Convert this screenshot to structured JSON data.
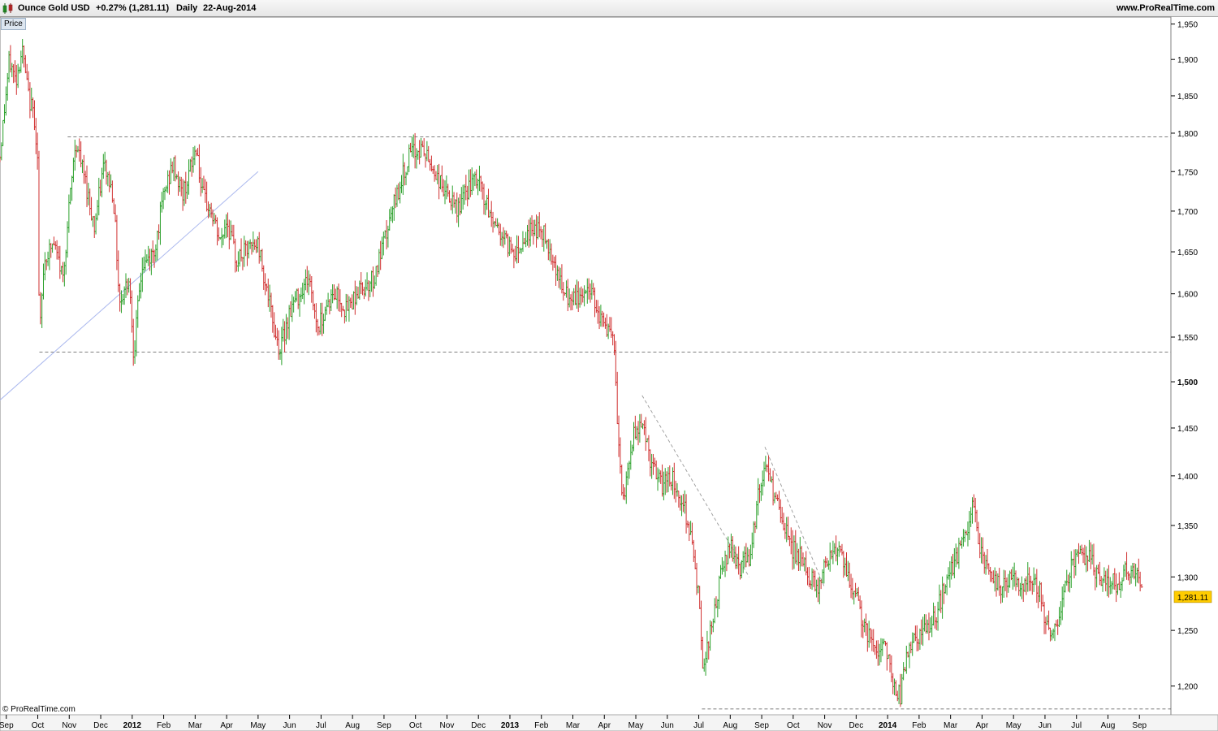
{
  "header": {
    "instrument": "Ounce Gold USD",
    "change": "+0.27% (1,281.11)",
    "period": "Daily",
    "date": "22-Aug-2014",
    "website": "www.ProRealTime.com"
  },
  "panel_label": "Price",
  "copyright": "© ProRealTime.com",
  "colors": {
    "up": "#2aa02a",
    "down": "#d03030",
    "last_price_bg": "#ffcc00",
    "trendline": "#aab8ee",
    "support_line": "#555555"
  },
  "chart_data": {
    "type": "bar",
    "title": "Ounce Gold USD",
    "timeframe": "Daily",
    "ylim": [
      1175,
      1960
    ],
    "y_ticks": [
      1200,
      1250,
      1300,
      1350,
      1400,
      1450,
      1500,
      1550,
      1600,
      1650,
      1700,
      1750,
      1800,
      1850,
      1900,
      1950
    ],
    "y_tick_labels": [
      "1,200",
      "1,250",
      "1,300",
      "1,350",
      "1,400",
      "1,450",
      "1,500",
      "1,550",
      "1,600",
      "1,650",
      "1,700",
      "1,750",
      "1,800",
      "1,850",
      "1,900",
      "1,950"
    ],
    "x_ticks": [
      {
        "label": "Sep",
        "month": 0
      },
      {
        "label": "Oct",
        "month": 1
      },
      {
        "label": "Nov",
        "month": 2
      },
      {
        "label": "Dec",
        "month": 3
      },
      {
        "label": "2012",
        "month": 4,
        "bold": true
      },
      {
        "label": "Feb",
        "month": 5
      },
      {
        "label": "Mar",
        "month": 6
      },
      {
        "label": "Apr",
        "month": 7
      },
      {
        "label": "May",
        "month": 8
      },
      {
        "label": "Jun",
        "month": 9
      },
      {
        "label": "Jul",
        "month": 10
      },
      {
        "label": "Aug",
        "month": 11
      },
      {
        "label": "Sep",
        "month": 12
      },
      {
        "label": "Oct",
        "month": 13
      },
      {
        "label": "Nov",
        "month": 14
      },
      {
        "label": "Dec",
        "month": 15
      },
      {
        "label": "2013",
        "month": 16,
        "bold": true
      },
      {
        "label": "Feb",
        "month": 17
      },
      {
        "label": "Mar",
        "month": 18
      },
      {
        "label": "Apr",
        "month": 19
      },
      {
        "label": "May",
        "month": 20
      },
      {
        "label": "Jun",
        "month": 21
      },
      {
        "label": "Jul",
        "month": 22
      },
      {
        "label": "Aug",
        "month": 23
      },
      {
        "label": "Sep",
        "month": 24
      },
      {
        "label": "Oct",
        "month": 25
      },
      {
        "label": "Nov",
        "month": 26
      },
      {
        "label": "Dec",
        "month": 27
      },
      {
        "label": "2014",
        "month": 28,
        "bold": true
      },
      {
        "label": "Feb",
        "month": 29
      },
      {
        "label": "Mar",
        "month": 30
      },
      {
        "label": "Apr",
        "month": 31
      },
      {
        "label": "May",
        "month": 32
      },
      {
        "label": "Jun",
        "month": 33
      },
      {
        "label": "Jul",
        "month": 34
      },
      {
        "label": "Aug",
        "month": 35
      },
      {
        "label": "Sep",
        "month": 36
      }
    ],
    "x_range_months": [
      -0.2,
      37.0
    ],
    "last_price": 1281.11,
    "last_price_label": "1,281.11",
    "price_path": [
      [
        -0.2,
        1770
      ],
      [
        0.1,
        1900
      ],
      [
        0.3,
        1870
      ],
      [
        0.5,
        1915
      ],
      [
        0.7,
        1850
      ],
      [
        0.9,
        1820
      ],
      [
        1.0,
        1760
      ],
      [
        1.05,
        1540
      ],
      [
        1.2,
        1640
      ],
      [
        1.5,
        1660
      ],
      [
        1.8,
        1620
      ],
      [
        2.2,
        1790
      ],
      [
        2.5,
        1740
      ],
      [
        2.8,
        1680
      ],
      [
        3.1,
        1760
      ],
      [
        3.4,
        1720
      ],
      [
        3.6,
        1590
      ],
      [
        3.9,
        1620
      ],
      [
        4.05,
        1530
      ],
      [
        4.3,
        1630
      ],
      [
        4.7,
        1650
      ],
      [
        5.0,
        1720
      ],
      [
        5.3,
        1760
      ],
      [
        5.6,
        1720
      ],
      [
        5.9,
        1760
      ],
      [
        6.05,
        1785
      ],
      [
        6.2,
        1720
      ],
      [
        6.5,
        1700
      ],
      [
        6.8,
        1660
      ],
      [
        7.0,
        1690
      ],
      [
        7.3,
        1640
      ],
      [
        7.6,
        1650
      ],
      [
        8.0,
        1660
      ],
      [
        8.3,
        1600
      ],
      [
        8.5,
        1560
      ],
      [
        8.7,
        1535
      ],
      [
        9.0,
        1580
      ],
      [
        9.3,
        1600
      ],
      [
        9.6,
        1620
      ],
      [
        9.9,
        1560
      ],
      [
        10.2,
        1590
      ],
      [
        10.5,
        1600
      ],
      [
        10.8,
        1580
      ],
      [
        11.1,
        1600
      ],
      [
        11.4,
        1610
      ],
      [
        11.7,
        1620
      ],
      [
        12.0,
        1660
      ],
      [
        12.4,
        1720
      ],
      [
        12.8,
        1770
      ],
      [
        13.2,
        1780
      ],
      [
        13.6,
        1750
      ],
      [
        14.0,
        1720
      ],
      [
        14.3,
        1700
      ],
      [
        14.7,
        1730
      ],
      [
        15.0,
        1740
      ],
      [
        15.3,
        1700
      ],
      [
        15.6,
        1680
      ],
      [
        15.9,
        1660
      ],
      [
        16.2,
        1650
      ],
      [
        16.5,
        1670
      ],
      [
        16.8,
        1680
      ],
      [
        17.1,
        1670
      ],
      [
        17.4,
        1640
      ],
      [
        17.7,
        1600
      ],
      [
        18.0,
        1590
      ],
      [
        18.3,
        1600
      ],
      [
        18.6,
        1605
      ],
      [
        18.9,
        1570
      ],
      [
        19.1,
        1560
      ],
      [
        19.3,
        1540
      ],
      [
        19.45,
        1430
      ],
      [
        19.6,
        1370
      ],
      [
        19.9,
        1440
      ],
      [
        20.2,
        1460
      ],
      [
        20.5,
        1410
      ],
      [
        20.8,
        1390
      ],
      [
        21.1,
        1400
      ],
      [
        21.4,
        1380
      ],
      [
        21.7,
        1350
      ],
      [
        22.0,
        1280
      ],
      [
        22.1,
        1220
      ],
      [
        22.4,
        1250
      ],
      [
        22.7,
        1300
      ],
      [
        23.0,
        1330
      ],
      [
        23.3,
        1310
      ],
      [
        23.6,
        1320
      ],
      [
        23.9,
        1380
      ],
      [
        24.1,
        1410
      ],
      [
        24.3,
        1390
      ],
      [
        24.6,
        1360
      ],
      [
        24.9,
        1330
      ],
      [
        25.2,
        1320
      ],
      [
        25.5,
        1300
      ],
      [
        25.8,
        1290
      ],
      [
        26.1,
        1320
      ],
      [
        26.4,
        1330
      ],
      [
        26.7,
        1300
      ],
      [
        27.0,
        1280
      ],
      [
        27.3,
        1250
      ],
      [
        27.6,
        1230
      ],
      [
        27.9,
        1240
      ],
      [
        28.2,
        1200
      ],
      [
        28.4,
        1190
      ],
      [
        28.6,
        1230
      ],
      [
        28.9,
        1240
      ],
      [
        29.2,
        1250
      ],
      [
        29.5,
        1260
      ],
      [
        29.8,
        1290
      ],
      [
        30.2,
        1320
      ],
      [
        30.5,
        1340
      ],
      [
        30.7,
        1370
      ],
      [
        31.0,
        1320
      ],
      [
        31.3,
        1300
      ],
      [
        31.6,
        1290
      ],
      [
        31.9,
        1300
      ],
      [
        32.2,
        1290
      ],
      [
        32.5,
        1300
      ],
      [
        32.8,
        1290
      ],
      [
        33.0,
        1260
      ],
      [
        33.2,
        1245
      ],
      [
        33.5,
        1270
      ],
      [
        33.8,
        1310
      ],
      [
        34.1,
        1320
      ],
      [
        34.4,
        1320
      ],
      [
        34.7,
        1300
      ],
      [
        35.0,
        1300
      ],
      [
        35.3,
        1290
      ],
      [
        35.6,
        1310
      ],
      [
        35.9,
        1300
      ],
      [
        36.1,
        1281
      ]
    ],
    "annotations": {
      "resistance_1795": {
        "price": 1795,
        "from_month": 1.95,
        "style": "dashed"
      },
      "support_1533": {
        "price": 1533,
        "from_month": 1.05,
        "style": "dashed"
      },
      "support_1180": {
        "price": 1180,
        "from_month": 22.1,
        "style": "dashed"
      },
      "uptrend_line": {
        "from": [
          -0.2,
          1480
        ],
        "to": [
          8.0,
          1750
        ],
        "style": "solid"
      },
      "downtrend_1": {
        "from": [
          20.2,
          1485
        ],
        "to": [
          23.6,
          1300
        ],
        "style": "dashed"
      },
      "downtrend_2": {
        "from": [
          24.1,
          1430
        ],
        "to": [
          26.0,
          1290
        ],
        "style": "dashed"
      }
    }
  }
}
